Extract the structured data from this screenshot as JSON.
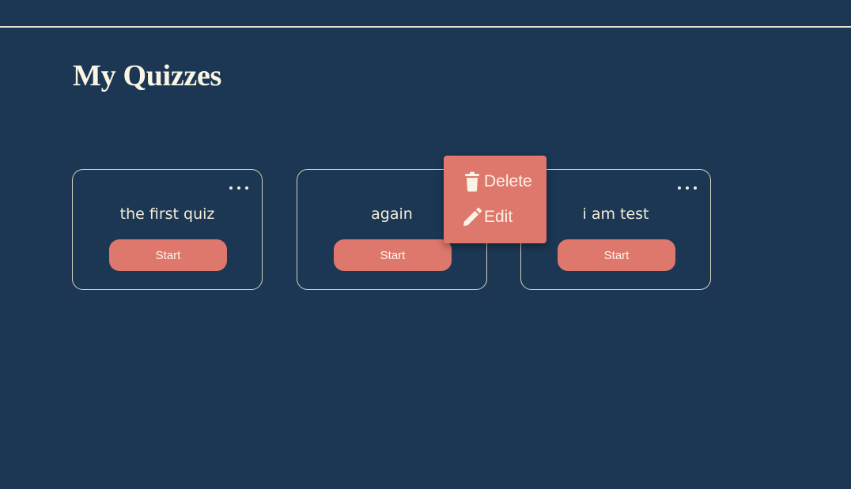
{
  "page": {
    "title": "My Quizzes"
  },
  "quizzes": [
    {
      "title": "the first quiz",
      "start_label": "Start",
      "more_icon": "more-horizontal-icon"
    },
    {
      "title": "again",
      "start_label": "Start",
      "more_icon": "more-horizontal-icon"
    },
    {
      "title": "i am test",
      "start_label": "Start",
      "more_icon": "more-horizontal-icon"
    }
  ],
  "context_menu": {
    "items": [
      {
        "label": "Delete",
        "icon": "trash-icon"
      },
      {
        "label": "Edit",
        "icon": "pencil-icon"
      }
    ]
  },
  "colors": {
    "background": "#1b3754",
    "accent": "#df786c",
    "text": "#f3ecd8",
    "card_border": "#d6cfbe"
  }
}
